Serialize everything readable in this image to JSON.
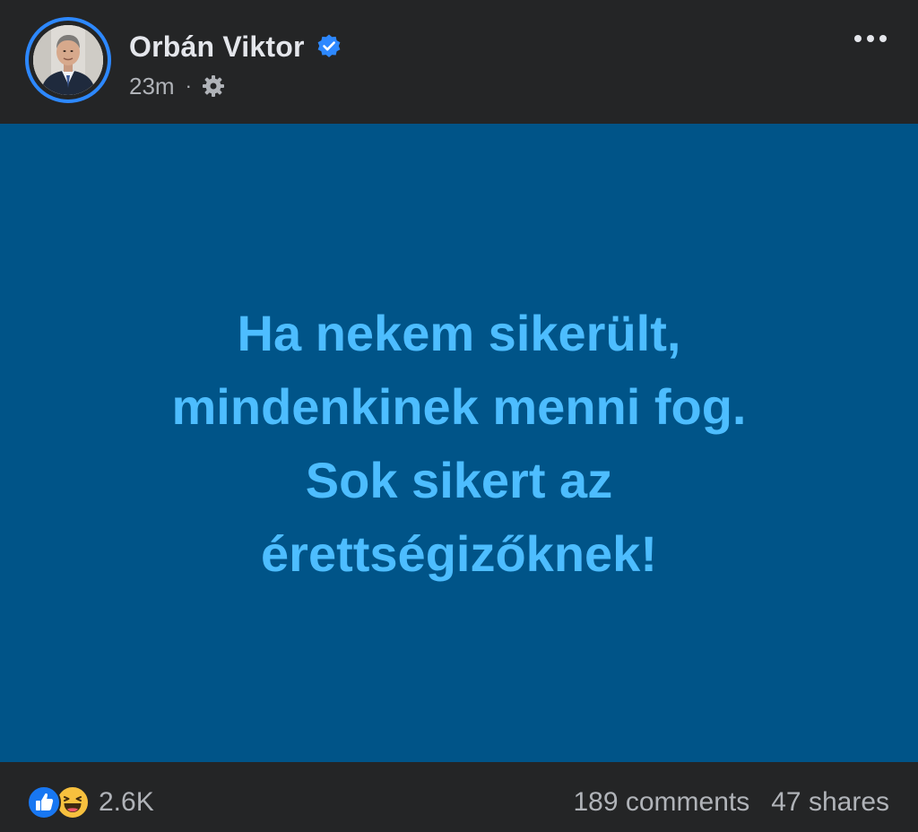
{
  "post": {
    "author": {
      "name": "Orbán Viktor",
      "verified": true,
      "avatar": "profile-photo"
    },
    "timestamp": "23m",
    "meta_separator": "·",
    "privacy_icon": "gear-icon",
    "menu_icon": "more-horizontal-icon",
    "background_color": "#005488",
    "text_color": "#4dbdff",
    "text_lines": [
      "Ha nekem sikerült,",
      "mindenkinek menni fog.",
      "Sok sikert az",
      "érettségizőknek!"
    ]
  },
  "footer": {
    "reactions": [
      "like-icon",
      "haha-icon"
    ],
    "reaction_count": "2.6K",
    "comments": "189 comments",
    "shares": "47 shares"
  },
  "colors": {
    "page_bg": "#242526",
    "verified_blue": "#2d88ff",
    "primary_text": "#e4e6eb",
    "secondary_text": "#b0b3b8"
  }
}
